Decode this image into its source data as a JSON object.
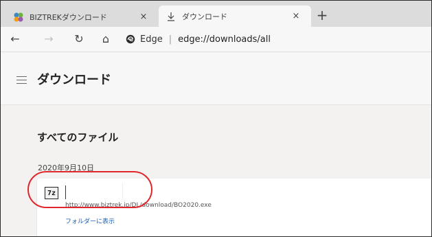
{
  "tabs": [
    {
      "title": "BIZTREKダウンロード",
      "close": "×",
      "icon": "biztrek-favicon"
    },
    {
      "title": "ダウンロード",
      "close": "×",
      "icon": "download-icon"
    }
  ],
  "new_tab": "+",
  "nav": {
    "back": "←",
    "forward": "→",
    "refresh": "↻",
    "home": "⌂"
  },
  "address": {
    "browser": "Edge",
    "separator": "|",
    "url": "edge://downloads/all"
  },
  "page": {
    "title": "ダウンロード",
    "section_title": "すべてのファイル"
  },
  "downloads": {
    "date": "2020年9月10日",
    "item": {
      "icon_text": "7z",
      "url": "http://www.biztrek.jp/DL/download/BO2020.exe",
      "folder_link": "フォルダーに表示"
    }
  },
  "colors": {
    "highlight": "#e0262a",
    "link": "#1a5fb4"
  }
}
